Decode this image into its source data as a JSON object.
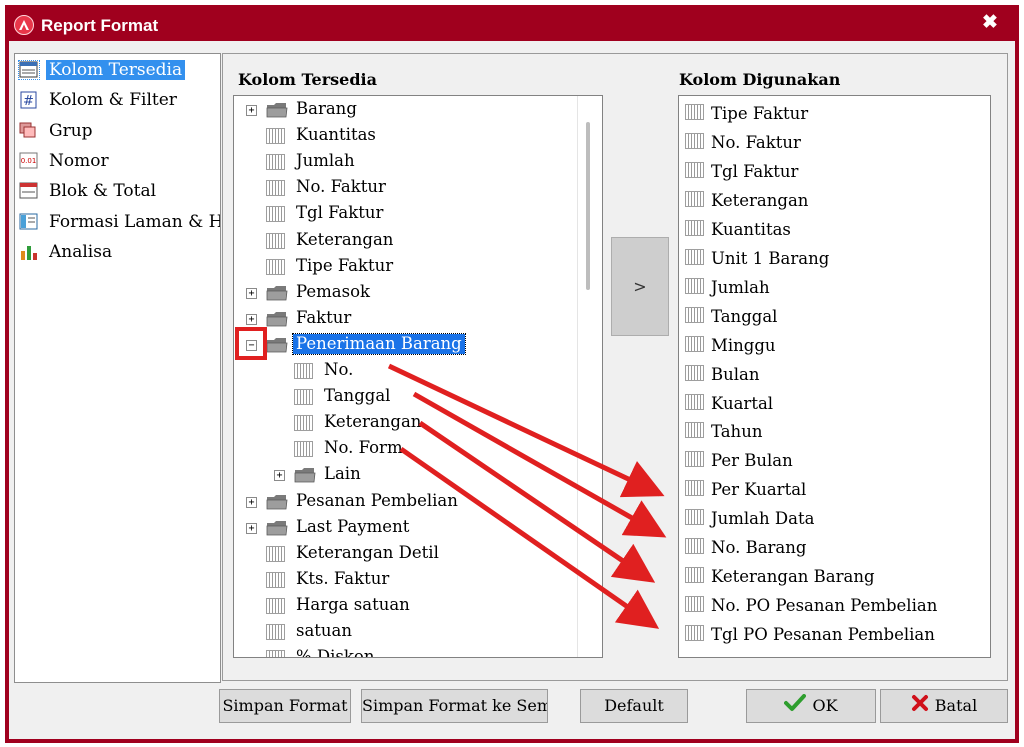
{
  "window": {
    "title": "Report Format",
    "close_glyph": "✖"
  },
  "nav": {
    "items": [
      {
        "label": "Kolom Tersedia",
        "icon": "table-list-icon",
        "selected": true
      },
      {
        "label": "Kolom & Filter",
        "icon": "hash-filter-icon",
        "selected": false
      },
      {
        "label": "Grup",
        "icon": "group-icon",
        "selected": false
      },
      {
        "label": "Nomor",
        "icon": "number-icon",
        "selected": false
      },
      {
        "label": "Blok & Total",
        "icon": "block-total-icon",
        "selected": false
      },
      {
        "label": "Formasi Laman & Hur",
        "icon": "page-layout-icon",
        "selected": false
      },
      {
        "label": "Analisa",
        "icon": "bar-chart-icon",
        "selected": false
      }
    ]
  },
  "available": {
    "header": "Kolom Tersedia",
    "nodes": [
      {
        "label": "Barang",
        "kind": "folder",
        "expander": "+"
      },
      {
        "label": "Kuantitas",
        "kind": "column"
      },
      {
        "label": "Jumlah",
        "kind": "column"
      },
      {
        "label": "No. Faktur",
        "kind": "column"
      },
      {
        "label": "Tgl Faktur",
        "kind": "column"
      },
      {
        "label": "Keterangan",
        "kind": "column"
      },
      {
        "label": "Tipe Faktur",
        "kind": "column"
      },
      {
        "label": "Pemasok",
        "kind": "folder",
        "expander": "+"
      },
      {
        "label": "Faktur",
        "kind": "folder",
        "expander": "+"
      },
      {
        "label": "Penerimaan Barang",
        "kind": "folder",
        "expander": "−",
        "selected": true
      },
      {
        "label": "No.",
        "kind": "column",
        "child": true
      },
      {
        "label": "Tanggal",
        "kind": "column",
        "child": true
      },
      {
        "label": "Keterangan",
        "kind": "column",
        "child": true
      },
      {
        "label": "No. Form",
        "kind": "column",
        "child": true
      },
      {
        "label": "Lain",
        "kind": "folder",
        "expander": "+",
        "child": true
      },
      {
        "label": "Pesanan Pembelian",
        "kind": "folder",
        "expander": "+"
      },
      {
        "label": "Last Payment",
        "kind": "folder",
        "expander": "+"
      },
      {
        "label": "Keterangan Detil",
        "kind": "column"
      },
      {
        "label": "Kts. Faktur",
        "kind": "column"
      },
      {
        "label": "Harga satuan",
        "kind": "column"
      },
      {
        "label": "satuan",
        "kind": "column"
      },
      {
        "label": "% Diskon",
        "kind": "column"
      }
    ]
  },
  "add_button": ">",
  "used": {
    "header": "Kolom Digunakan",
    "items": [
      "Tipe Faktur",
      "No. Faktur",
      "Tgl Faktur",
      "Keterangan",
      "Kuantitas",
      "Unit 1 Barang",
      "Jumlah",
      "Tanggal",
      "Minggu",
      "Bulan",
      "Kuartal",
      "Tahun",
      "Per Bulan",
      "Per Kuartal",
      "Jumlah Data",
      "No. Barang",
      "Keterangan Barang",
      "No. PO Pesanan Pembelian",
      "Tgl PO Pesanan Pembelian"
    ]
  },
  "buttons": {
    "save_format": "Simpan Format",
    "save_format_all": "Simpan Format ke Semu",
    "default": "Default",
    "ok": "OK",
    "cancel": "Batal"
  },
  "colors": {
    "title_bar": "#a0001e",
    "selection": "#3390ee",
    "annotation": "#e02020",
    "ok_check": "#2e9e2e",
    "cancel_x": "#d0101a"
  }
}
